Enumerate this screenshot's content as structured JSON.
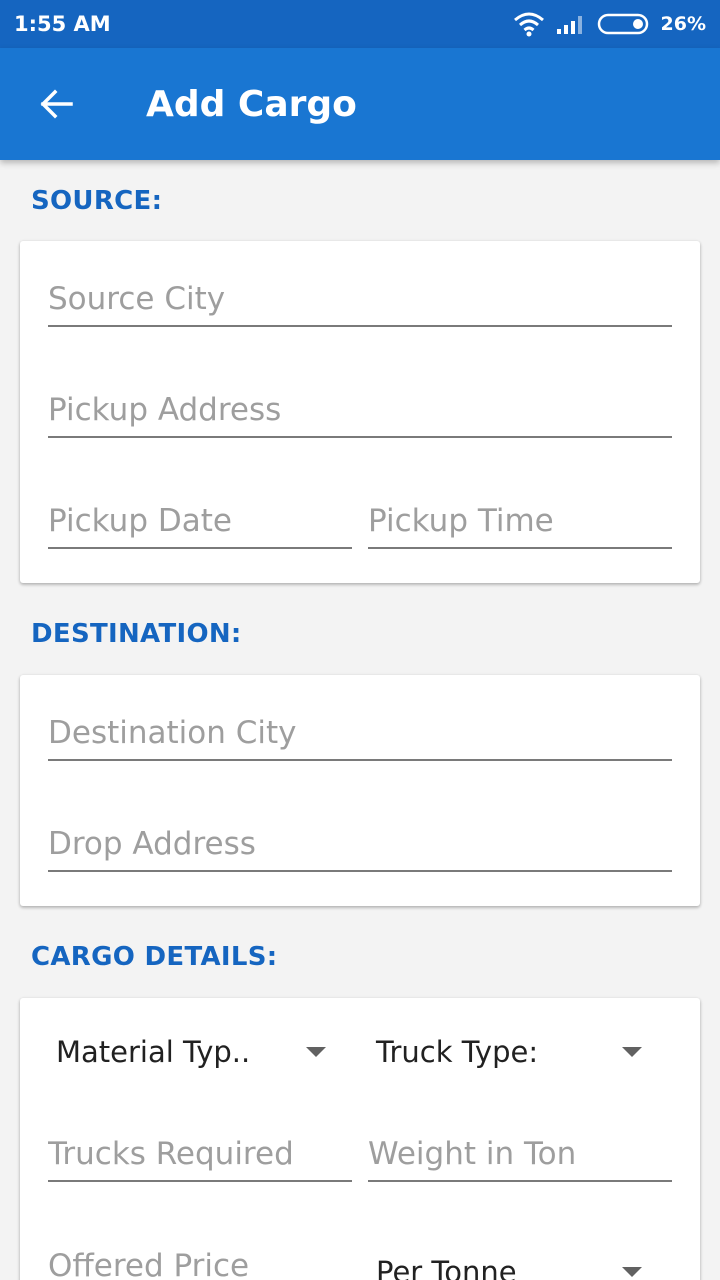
{
  "status_bar": {
    "time": "1:55 AM",
    "battery": "26%"
  },
  "app_bar": {
    "title": "Add Cargo"
  },
  "source": {
    "header": "SOURCE:",
    "city_placeholder": "Source City",
    "address_placeholder": "Pickup Address",
    "date_placeholder": "Pickup Date",
    "time_placeholder": "Pickup Time"
  },
  "destination": {
    "header": "DESTINATION:",
    "city_placeholder": "Destination City",
    "address_placeholder": "Drop Address"
  },
  "cargo": {
    "header": "CARGO DETAILS:",
    "material_type": "Material Typ..",
    "truck_type": "Truck Type:",
    "trucks_placeholder": "Trucks Required",
    "weight_placeholder": "Weight in Ton",
    "price_placeholder": "Offered Price",
    "price_unit": "Per Tonne"
  }
}
